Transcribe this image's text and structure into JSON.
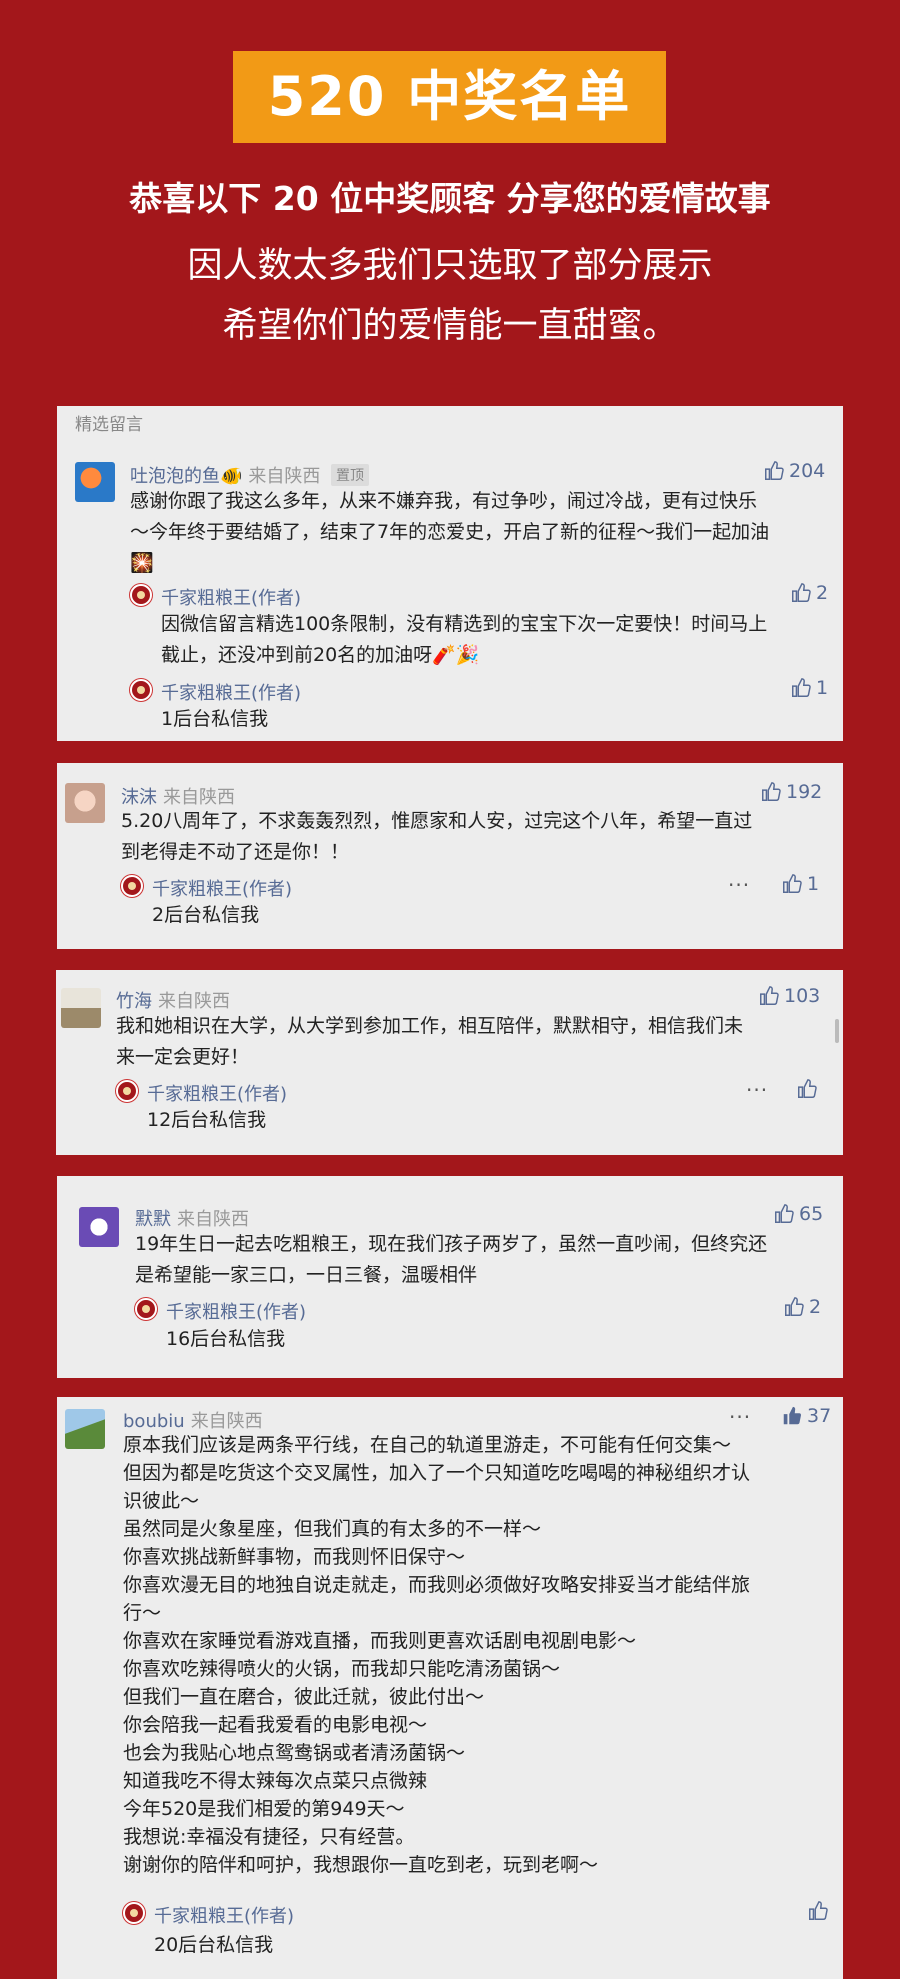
{
  "header": {
    "banner": "520 中奖名单",
    "headline": "恭喜以下 20 位中奖顾客 分享您的爱情故事",
    "sub1": "因人数太多我们只选取了部分展示",
    "sub2": "希望你们的爱情能一直甜蜜。"
  },
  "section_label": "精选留言",
  "comments": [
    {
      "user": "吐泡泡的鱼🐠",
      "loc": "来自陕西",
      "pinned": "置顶",
      "likes": "204",
      "lines": [
        "感谢你跟了我这么多年，从来不嫌弃我，有过争吵，闹过冷战，更有过快乐",
        "～今年终于要结婚了，结束了7年的恋爱史，开启了新的征程～我们一起加油",
        "🎇"
      ],
      "replies": [
        {
          "author": "千家粗粮王(作者)",
          "likes": "2",
          "lines": [
            "因微信留言精选100条限制，没有精选到的宝宝下次一定要快！时间马上",
            "截止，还没冲到前20名的加油呀🧨🎉"
          ]
        },
        {
          "author": "千家粗粮王(作者)",
          "likes": "1",
          "lines": [
            "1后台私信我"
          ]
        }
      ]
    },
    {
      "user": "沫沫",
      "loc": "来自陕西",
      "likes": "192",
      "lines": [
        "5.20八周年了，不求轰轰烈烈，惟愿家和人安，过完这个八年，希望一直过",
        "到老得走不动了还是你！！"
      ],
      "replies": [
        {
          "author": "千家粗粮王(作者)",
          "likes": "1",
          "lines": [
            "2后台私信我"
          ]
        }
      ]
    },
    {
      "user": "竹海",
      "loc": "来自陕西",
      "likes": "103",
      "lines": [
        "我和她相识在大学，从大学到参加工作，相互陪伴，默默相守，相信我们未",
        "来一定会更好！"
      ],
      "replies": [
        {
          "author": "千家粗粮王(作者)",
          "likes": "",
          "lines": [
            "12后台私信我"
          ]
        }
      ]
    },
    {
      "user": "默默",
      "loc": "来自陕西",
      "likes": "65",
      "lines": [
        "19年生日一起去吃粗粮王，现在我们孩子两岁了，虽然一直吵闹，但终究还",
        "是希望能一家三口，一日三餐，温暖相伴"
      ],
      "replies": [
        {
          "author": "千家粗粮王(作者)",
          "likes": "2",
          "lines": [
            "16后台私信我"
          ]
        }
      ]
    },
    {
      "user": "boubiu",
      "loc": "来自陕西",
      "likes": "37",
      "lines": [
        "原本我们应该是两条平行线，在自己的轨道里游走，不可能有任何交集～",
        "但因为都是吃货这个交叉属性，加入了一个只知道吃吃喝喝的神秘组织才认",
        "识彼此～",
        "虽然同是火象星座，但我们真的有太多的不一样～",
        "你喜欢挑战新鲜事物，而我则怀旧保守～",
        "你喜欢漫无目的地独自说走就走，而我则必须做好攻略安排妥当才能结伴旅",
        "行～",
        "你喜欢在家睡觉看游戏直播，而我则更喜欢话剧电视剧电影～",
        "你喜欢吃辣得喷火的火锅，而我却只能吃清汤菌锅～",
        "但我们一直在磨合，彼此迁就，彼此付出～",
        "你会陪我一起看我爱看的电影电视～",
        "也会为我贴心地点鸳鸯锅或者清汤菌锅～",
        "知道我吃不得太辣每次点菜只点微辣",
        "今年520是我们相爱的第949天～",
        "我想说:幸福没有捷径，只有经营。",
        "谢谢你的陪伴和呵护，我想跟你一直吃到老，玩到老啊～"
      ],
      "replies": [
        {
          "author": "千家粗粮王(作者)",
          "likes": "",
          "lines": [
            "20后台私信我"
          ]
        }
      ]
    }
  ],
  "more_label": "···",
  "colors": {
    "bg": "#a3171b",
    "banner": "#f29a16",
    "name": "#576b95",
    "card": "#ededed"
  }
}
